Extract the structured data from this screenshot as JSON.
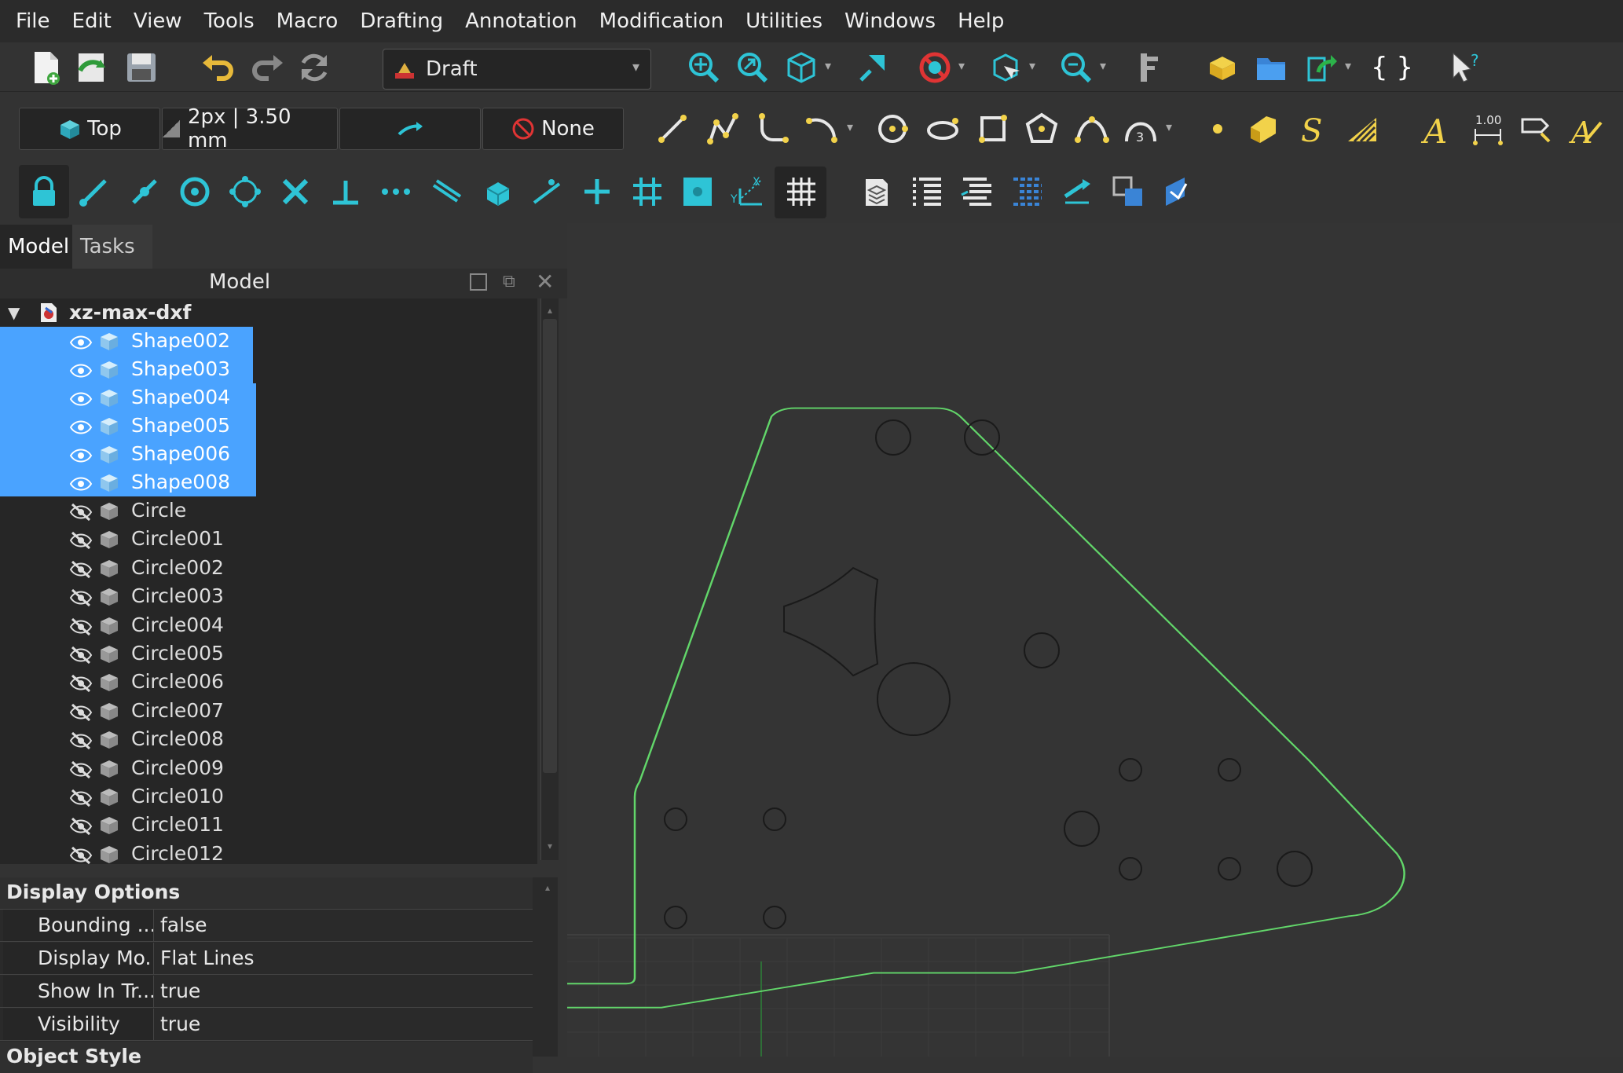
{
  "menu": [
    "File",
    "Edit",
    "View",
    "Tools",
    "Macro",
    "Drafting",
    "Annotation",
    "Modification",
    "Utilities",
    "Windows",
    "Help"
  ],
  "workbench": {
    "selected": "Draft"
  },
  "draft_toolbar": {
    "view_label": "Top",
    "line_style_label": "2px | 3.50 mm",
    "snap_label": "None"
  },
  "panel": {
    "tabs": [
      "Model",
      "Tasks"
    ],
    "header_title": "Model",
    "document_name": "xz-max-dxf",
    "selected_items": [
      "Shape002",
      "Shape003",
      "Shape004",
      "Shape005",
      "Shape006",
      "Shape008"
    ],
    "hidden_items": [
      "Circle",
      "Circle001",
      "Circle002",
      "Circle003",
      "Circle004",
      "Circle005",
      "Circle006",
      "Circle007",
      "Circle008",
      "Circle009",
      "Circle010",
      "Circle011",
      "Circle012"
    ]
  },
  "properties": {
    "section_title": "Display Options",
    "rows": [
      {
        "name": "Bounding ...",
        "value": "false"
      },
      {
        "name": "Display Mo...",
        "value": "Flat Lines"
      },
      {
        "name": "Show In Tr...",
        "value": "true"
      },
      {
        "name": "Visibility",
        "value": "true"
      }
    ],
    "next_section": "Object Style"
  },
  "colors": {
    "accent": "#4aa3ff",
    "icon_cyan": "#2ec4d6",
    "shape_outline": "#62d66a",
    "background": "#333333"
  }
}
